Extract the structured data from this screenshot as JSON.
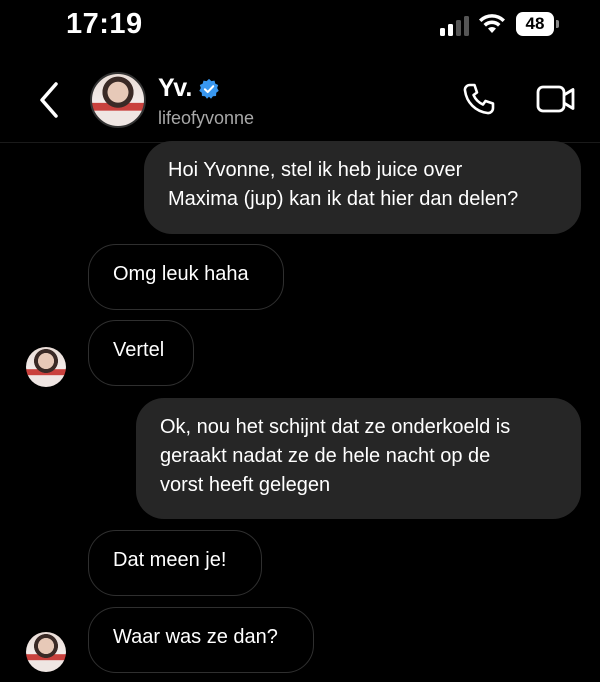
{
  "status_bar": {
    "time": "17:19",
    "battery": "48",
    "icons": [
      "cellular-signal-icon",
      "wifi-icon",
      "battery-icon"
    ]
  },
  "header": {
    "name": "Yv.",
    "handle": "lifeofyvonne",
    "verified": true,
    "icons": [
      "back-chevron-icon",
      "verified-badge-icon",
      "phone-icon",
      "video-camera-icon"
    ]
  },
  "messages": [
    {
      "direction": "outgoing",
      "text": "Hoi Yvonne, stel ik heb juice over\nMaxima (jup) kan ik dat hier dan delen?"
    },
    {
      "direction": "incoming",
      "text": "Omg leuk haha"
    },
    {
      "direction": "incoming",
      "text": "Vertel"
    },
    {
      "direction": "outgoing",
      "text": "Ok, nou het schijnt dat ze onderkoeld is\ngeraakt nadat ze de hele nacht op de\nvorst heeft gelegen"
    },
    {
      "direction": "incoming",
      "text": "Dat meen je!"
    },
    {
      "direction": "incoming",
      "text": "Waar was ze dan?"
    }
  ],
  "colors": {
    "background": "#000000",
    "outgoing_bubble": "#262626",
    "incoming_border": "#2f2f2f",
    "secondary_text": "#a8a8a8",
    "verified_blue": "#3897f0"
  }
}
